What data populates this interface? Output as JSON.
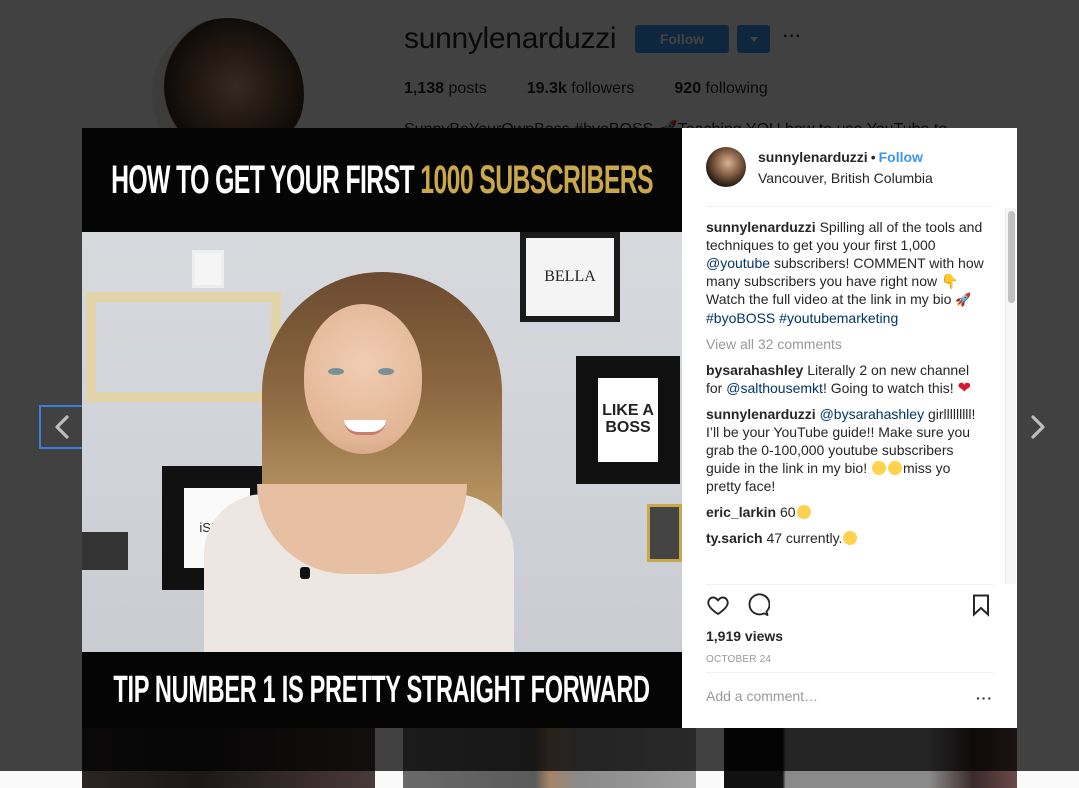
{
  "profile": {
    "username": "sunnylenarduzzi",
    "follow_label": "Follow",
    "more_label": "···",
    "stats": [
      {
        "value": "1,138",
        "label": "posts"
      },
      {
        "value": "19.3k",
        "label": "followers"
      },
      {
        "value": "920",
        "label": "following"
      }
    ],
    "bio_partial": "SunnyBeYourOwnBoss #byoBOSS 🚀Teaching YOU how to use YouTube to"
  },
  "media": {
    "headline_white": "HOW TO GET YOUR FIRST",
    "headline_gold": "1000 SUBSCRIBERS",
    "caption_bottom": "TIP NUMBER 1 IS PRETTY STRAIGHT FORWARD",
    "wall_signs": {
      "bella": "BELLA",
      "boss": "LIKE A BOSS",
      "slay": "iSLAY"
    }
  },
  "post": {
    "username": "sunnylenarduzzi",
    "separator": "•",
    "follow_label": "Follow",
    "location": "Vancouver, British Columbia",
    "caption": {
      "username": "sunnylenarduzzi",
      "text_1": "Spilling all of the tools and techniques to get you your first 1,000",
      "mention": "@youtube",
      "text_2": "subscribers! COMMENT with how many subscribers you have right now",
      "text_3": "Watch the full video at the link in my bio",
      "tag_1": "#byoBOSS",
      "tag_2": "#youtubemarketing"
    },
    "view_all_comments": "View all 32 comments",
    "comments": [
      {
        "username": "bysarahashley",
        "text_1": "Literally 2 on new channel for",
        "mention": "@salthousemkt",
        "text_2": "! Going to watch this!"
      },
      {
        "username": "sunnylenarduzzi",
        "mention": "@bysarahashley",
        "text_1": "girlllllllll! I’ll be your YouTube guide!! Make sure you grab the 0-100,000 youtube subscribers guide in the link in my bio!",
        "text_2": "miss yo pretty face!"
      },
      {
        "username": "eric_larkin",
        "text_1": "60"
      },
      {
        "username": "ty.sarich",
        "text_1": "47 currently."
      }
    ],
    "views": "1,919 views",
    "date": "OCTOBER 24",
    "add_comment_placeholder": "Add a comment…",
    "more_options_label": "···"
  },
  "colors": {
    "accent": "#3897f0",
    "link": "#003569",
    "focus_ring": "#3b7dd8",
    "headline_gold": "#c9a84c"
  }
}
